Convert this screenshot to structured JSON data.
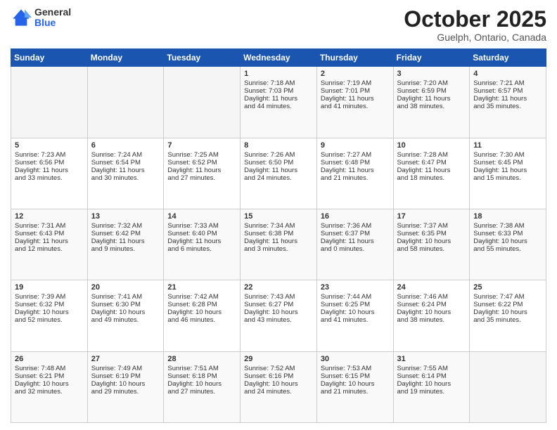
{
  "header": {
    "logo": {
      "general": "General",
      "blue": "Blue"
    },
    "title": "October 2025",
    "location": "Guelph, Ontario, Canada"
  },
  "weekdays": [
    "Sunday",
    "Monday",
    "Tuesday",
    "Wednesday",
    "Thursday",
    "Friday",
    "Saturday"
  ],
  "weeks": [
    [
      {
        "day": "",
        "info": ""
      },
      {
        "day": "",
        "info": ""
      },
      {
        "day": "",
        "info": ""
      },
      {
        "day": "1",
        "info": "Sunrise: 7:18 AM\nSunset: 7:03 PM\nDaylight: 11 hours\nand 44 minutes."
      },
      {
        "day": "2",
        "info": "Sunrise: 7:19 AM\nSunset: 7:01 PM\nDaylight: 11 hours\nand 41 minutes."
      },
      {
        "day": "3",
        "info": "Sunrise: 7:20 AM\nSunset: 6:59 PM\nDaylight: 11 hours\nand 38 minutes."
      },
      {
        "day": "4",
        "info": "Sunrise: 7:21 AM\nSunset: 6:57 PM\nDaylight: 11 hours\nand 35 minutes."
      }
    ],
    [
      {
        "day": "5",
        "info": "Sunrise: 7:23 AM\nSunset: 6:56 PM\nDaylight: 11 hours\nand 33 minutes."
      },
      {
        "day": "6",
        "info": "Sunrise: 7:24 AM\nSunset: 6:54 PM\nDaylight: 11 hours\nand 30 minutes."
      },
      {
        "day": "7",
        "info": "Sunrise: 7:25 AM\nSunset: 6:52 PM\nDaylight: 11 hours\nand 27 minutes."
      },
      {
        "day": "8",
        "info": "Sunrise: 7:26 AM\nSunset: 6:50 PM\nDaylight: 11 hours\nand 24 minutes."
      },
      {
        "day": "9",
        "info": "Sunrise: 7:27 AM\nSunset: 6:48 PM\nDaylight: 11 hours\nand 21 minutes."
      },
      {
        "day": "10",
        "info": "Sunrise: 7:28 AM\nSunset: 6:47 PM\nDaylight: 11 hours\nand 18 minutes."
      },
      {
        "day": "11",
        "info": "Sunrise: 7:30 AM\nSunset: 6:45 PM\nDaylight: 11 hours\nand 15 minutes."
      }
    ],
    [
      {
        "day": "12",
        "info": "Sunrise: 7:31 AM\nSunset: 6:43 PM\nDaylight: 11 hours\nand 12 minutes."
      },
      {
        "day": "13",
        "info": "Sunrise: 7:32 AM\nSunset: 6:42 PM\nDaylight: 11 hours\nand 9 minutes."
      },
      {
        "day": "14",
        "info": "Sunrise: 7:33 AM\nSunset: 6:40 PM\nDaylight: 11 hours\nand 6 minutes."
      },
      {
        "day": "15",
        "info": "Sunrise: 7:34 AM\nSunset: 6:38 PM\nDaylight: 11 hours\nand 3 minutes."
      },
      {
        "day": "16",
        "info": "Sunrise: 7:36 AM\nSunset: 6:37 PM\nDaylight: 11 hours\nand 0 minutes."
      },
      {
        "day": "17",
        "info": "Sunrise: 7:37 AM\nSunset: 6:35 PM\nDaylight: 10 hours\nand 58 minutes."
      },
      {
        "day": "18",
        "info": "Sunrise: 7:38 AM\nSunset: 6:33 PM\nDaylight: 10 hours\nand 55 minutes."
      }
    ],
    [
      {
        "day": "19",
        "info": "Sunrise: 7:39 AM\nSunset: 6:32 PM\nDaylight: 10 hours\nand 52 minutes."
      },
      {
        "day": "20",
        "info": "Sunrise: 7:41 AM\nSunset: 6:30 PM\nDaylight: 10 hours\nand 49 minutes."
      },
      {
        "day": "21",
        "info": "Sunrise: 7:42 AM\nSunset: 6:28 PM\nDaylight: 10 hours\nand 46 minutes."
      },
      {
        "day": "22",
        "info": "Sunrise: 7:43 AM\nSunset: 6:27 PM\nDaylight: 10 hours\nand 43 minutes."
      },
      {
        "day": "23",
        "info": "Sunrise: 7:44 AM\nSunset: 6:25 PM\nDaylight: 10 hours\nand 41 minutes."
      },
      {
        "day": "24",
        "info": "Sunrise: 7:46 AM\nSunset: 6:24 PM\nDaylight: 10 hours\nand 38 minutes."
      },
      {
        "day": "25",
        "info": "Sunrise: 7:47 AM\nSunset: 6:22 PM\nDaylight: 10 hours\nand 35 minutes."
      }
    ],
    [
      {
        "day": "26",
        "info": "Sunrise: 7:48 AM\nSunset: 6:21 PM\nDaylight: 10 hours\nand 32 minutes."
      },
      {
        "day": "27",
        "info": "Sunrise: 7:49 AM\nSunset: 6:19 PM\nDaylight: 10 hours\nand 29 minutes."
      },
      {
        "day": "28",
        "info": "Sunrise: 7:51 AM\nSunset: 6:18 PM\nDaylight: 10 hours\nand 27 minutes."
      },
      {
        "day": "29",
        "info": "Sunrise: 7:52 AM\nSunset: 6:16 PM\nDaylight: 10 hours\nand 24 minutes."
      },
      {
        "day": "30",
        "info": "Sunrise: 7:53 AM\nSunset: 6:15 PM\nDaylight: 10 hours\nand 21 minutes."
      },
      {
        "day": "31",
        "info": "Sunrise: 7:55 AM\nSunset: 6:14 PM\nDaylight: 10 hours\nand 19 minutes."
      },
      {
        "day": "",
        "info": ""
      }
    ]
  ]
}
